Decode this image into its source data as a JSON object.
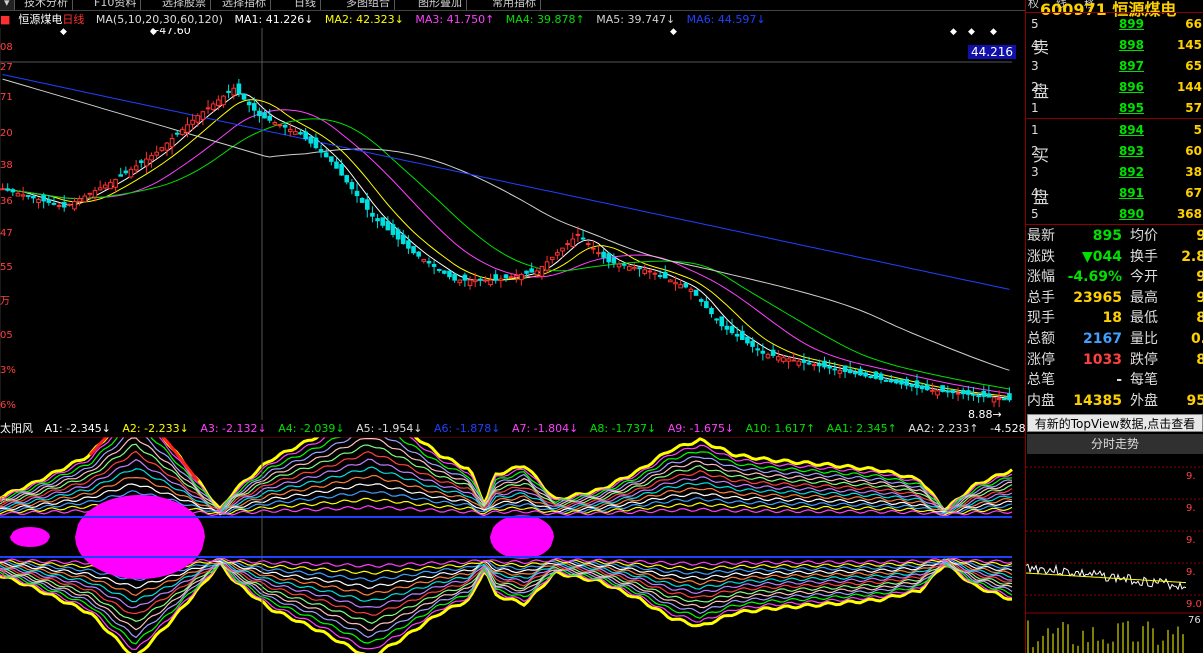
{
  "toolbar": {
    "items": [
      "技术分析",
      "F10资料",
      "选择股票",
      "选择指标",
      "日线",
      "多图组合",
      "图形叠加",
      "常用指标"
    ]
  },
  "stock": {
    "code": "600971",
    "name": "恒源煤电",
    "name_short": "恒源煤电"
  },
  "right_topbar": [
    "权",
    "线",
    "移"
  ],
  "main_head": {
    "title": "恒源煤电",
    "period": "日线",
    "ma_desc": "MA(5,10,20,30,60,120)",
    "ma1": "MA1: 41.226↓",
    "ma2": "MA2: 42.323↓",
    "ma3": "MA3: 41.750↑",
    "ma4": "MA4: 39.878↑",
    "ma5": "MA5: 39.747↓",
    "ma6": "MA6: 44.597↓"
  },
  "sub_head": {
    "title": "太阳风",
    "a1": "A1: -2.345↓",
    "a2": "A2: -2.233↓",
    "a3": "A3: -2.132↓",
    "a4": "A4: -2.039↓",
    "a5": "A5: -1.954↓",
    "a6": "A6: -1.878↓",
    "a7": "A7: -1.804↓",
    "a8": "A8: -1.737↓",
    "a9": "A9: -1.675↓",
    "a10": "A10: 1.617↑",
    "aa1": "AA1: 2.345↑",
    "aa2": "AA2: 2.233↑",
    "last": "-4.528↑"
  },
  "chart_labels": {
    "high_price": "47.60",
    "low_price": "8.88",
    "crosshair_price": "44.216"
  },
  "left_axis_ticks": [
    "08",
    "27",
    "71",
    "20",
    "38",
    "36",
    "47",
    "55",
    "万",
    "05",
    "3%",
    "6%",
    "0",
    "7"
  ],
  "order_book": {
    "sell_label": [
      "卖",
      "盘"
    ],
    "buy_label": [
      "买",
      "盘"
    ],
    "sell": [
      {
        "level": "5",
        "price": "899",
        "vol": "66"
      },
      {
        "level": "4",
        "price": "898",
        "vol": "145"
      },
      {
        "level": "3",
        "price": "897",
        "vol": "65"
      },
      {
        "level": "2",
        "price": "896",
        "vol": "144"
      },
      {
        "level": "1",
        "price": "895",
        "vol": "57"
      }
    ],
    "buy": [
      {
        "level": "1",
        "price": "894",
        "vol": "5"
      },
      {
        "level": "2",
        "price": "893",
        "vol": "60"
      },
      {
        "level": "3",
        "price": "892",
        "vol": "38"
      },
      {
        "level": "4",
        "price": "891",
        "vol": "67"
      },
      {
        "level": "5",
        "price": "890",
        "vol": "368"
      }
    ]
  },
  "stats": [
    {
      "k1": "最新",
      "v1": "895",
      "c1": "#00e000",
      "k2": "均价",
      "v2": "9"
    },
    {
      "k1": "涨跌",
      "v1": "▼044",
      "c1": "#00e000",
      "k2": "换手",
      "v2": "2.8"
    },
    {
      "k1": "涨幅",
      "v1": "-4.69%",
      "c1": "#00e000",
      "k2": "今开",
      "v2": "9"
    },
    {
      "k1": "总手",
      "v1": "23965",
      "c1": "#ffd000",
      "k2": "最高",
      "v2": "9"
    },
    {
      "k1": "现手",
      "v1": "18",
      "c1": "#ffd000",
      "k2": "最低",
      "v2": "8"
    },
    {
      "k1": "总额",
      "v1": "2167",
      "c1": "#40a0ff",
      "k2": "量比",
      "v2": "0."
    },
    {
      "k1": "涨停",
      "v1": "1033",
      "c1": "#ff4040",
      "k2": "跌停",
      "v2": "8"
    },
    {
      "k1": "总笔",
      "v1": "-",
      "c1": "#ddd",
      "k2": "每笔",
      "v2": ""
    },
    {
      "k1": "内盘",
      "v1": "14385",
      "c1": "#ffd000",
      "k2": "外盘",
      "v2": "95"
    }
  ],
  "topview_button": "有新的TopView数据,点击查看",
  "timeshare_title": "分时走势",
  "timeshare_ticks": [
    "9.",
    "9.",
    "9.",
    "9.",
    "9.0"
  ],
  "timeshare_vol_label": "76",
  "colors": {
    "up": "#ff3030",
    "down": "#00e0e0",
    "ma1": "#ffffff",
    "ma2": "#ffff00",
    "ma3": "#ff40ff",
    "ma4": "#00e000",
    "ma5": "#d0d0d0",
    "ma6": "#2040ff",
    "accent_yellow": "#ffd000",
    "border_red": "#8b0000"
  },
  "chart_data": {
    "type": "candlestick",
    "title": "恒源煤电 日线",
    "ma_series_names": [
      "MA1",
      "MA2",
      "MA3",
      "MA4",
      "MA5",
      "MA6"
    ],
    "ylim_note": "price axis not fully printed",
    "highest": 47.6,
    "lowest": 8.88,
    "ma_last": {
      "MA1": 41.226,
      "MA2": 42.323,
      "MA3": 41.75,
      "MA4": 39.878,
      "MA5": 39.747,
      "MA6": 44.597
    },
    "indicator": {
      "name": "太阳风",
      "values": {
        "A1": -2.345,
        "A2": -2.233,
        "A3": -2.132,
        "A4": -2.039,
        "A5": -1.954,
        "A6": -1.878,
        "A7": -1.804,
        "A8": -1.737,
        "A9": -1.675,
        "A10": 1.617,
        "AA1": 2.345,
        "AA2": 2.233
      }
    }
  }
}
